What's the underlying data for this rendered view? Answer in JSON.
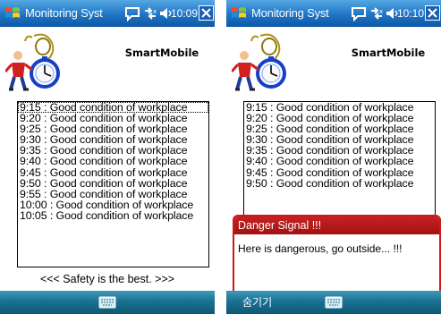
{
  "screens": [
    {
      "title": "Monitoring Syst",
      "clock": "10:09",
      "brand": "SmartMobile",
      "log": [
        "9:15 : Good condition of workplace",
        "9:20 : Good condition of workplace",
        "9:25 : Good condition of workplace",
        "9:30 : Good condition of workplace",
        "9:35 : Good condition of workplace",
        "9:40 : Good condition of workplace",
        "9:45 : Good condition of workplace",
        "9:50 : Good condition of workplace",
        "9:55 : Good condition of workplace",
        "10:00 : Good condition of workplace",
        "10:05 : Good condition of workplace"
      ],
      "footer": "<<< Safety is the best. >>>"
    },
    {
      "title": "Monitoring Syst",
      "clock": "10:10",
      "brand": "SmartMobile",
      "log": [
        "9:15 : Good condition of workplace",
        "9:20 : Good condition of workplace",
        "9:25 : Good condition of workplace",
        "9:30 : Good condition of workplace",
        "9:35 : Good condition of workplace",
        "9:40 : Good condition of workplace",
        "9:45 : Good condition of workplace",
        "9:50 : Good condition of workplace"
      ],
      "popup": {
        "title": "Danger Signal !!!",
        "message": "Here is dangerous, go outside... !!!"
      },
      "softkey_left": "숨기기"
    }
  ],
  "icons": {
    "start": "windows-flag-icon",
    "chat": "speech-bubble-icon",
    "network": "network-arrows-icon",
    "volume": "speaker-icon",
    "close": "close-icon",
    "keyboard": "keyboard-icon",
    "logo": "worker-with-stopwatch-icon"
  },
  "colors": {
    "titlebar": "#1f74c4",
    "softbar": "#1c7091",
    "popup_title": "#b71a1a",
    "popup_border": "#d01818"
  }
}
